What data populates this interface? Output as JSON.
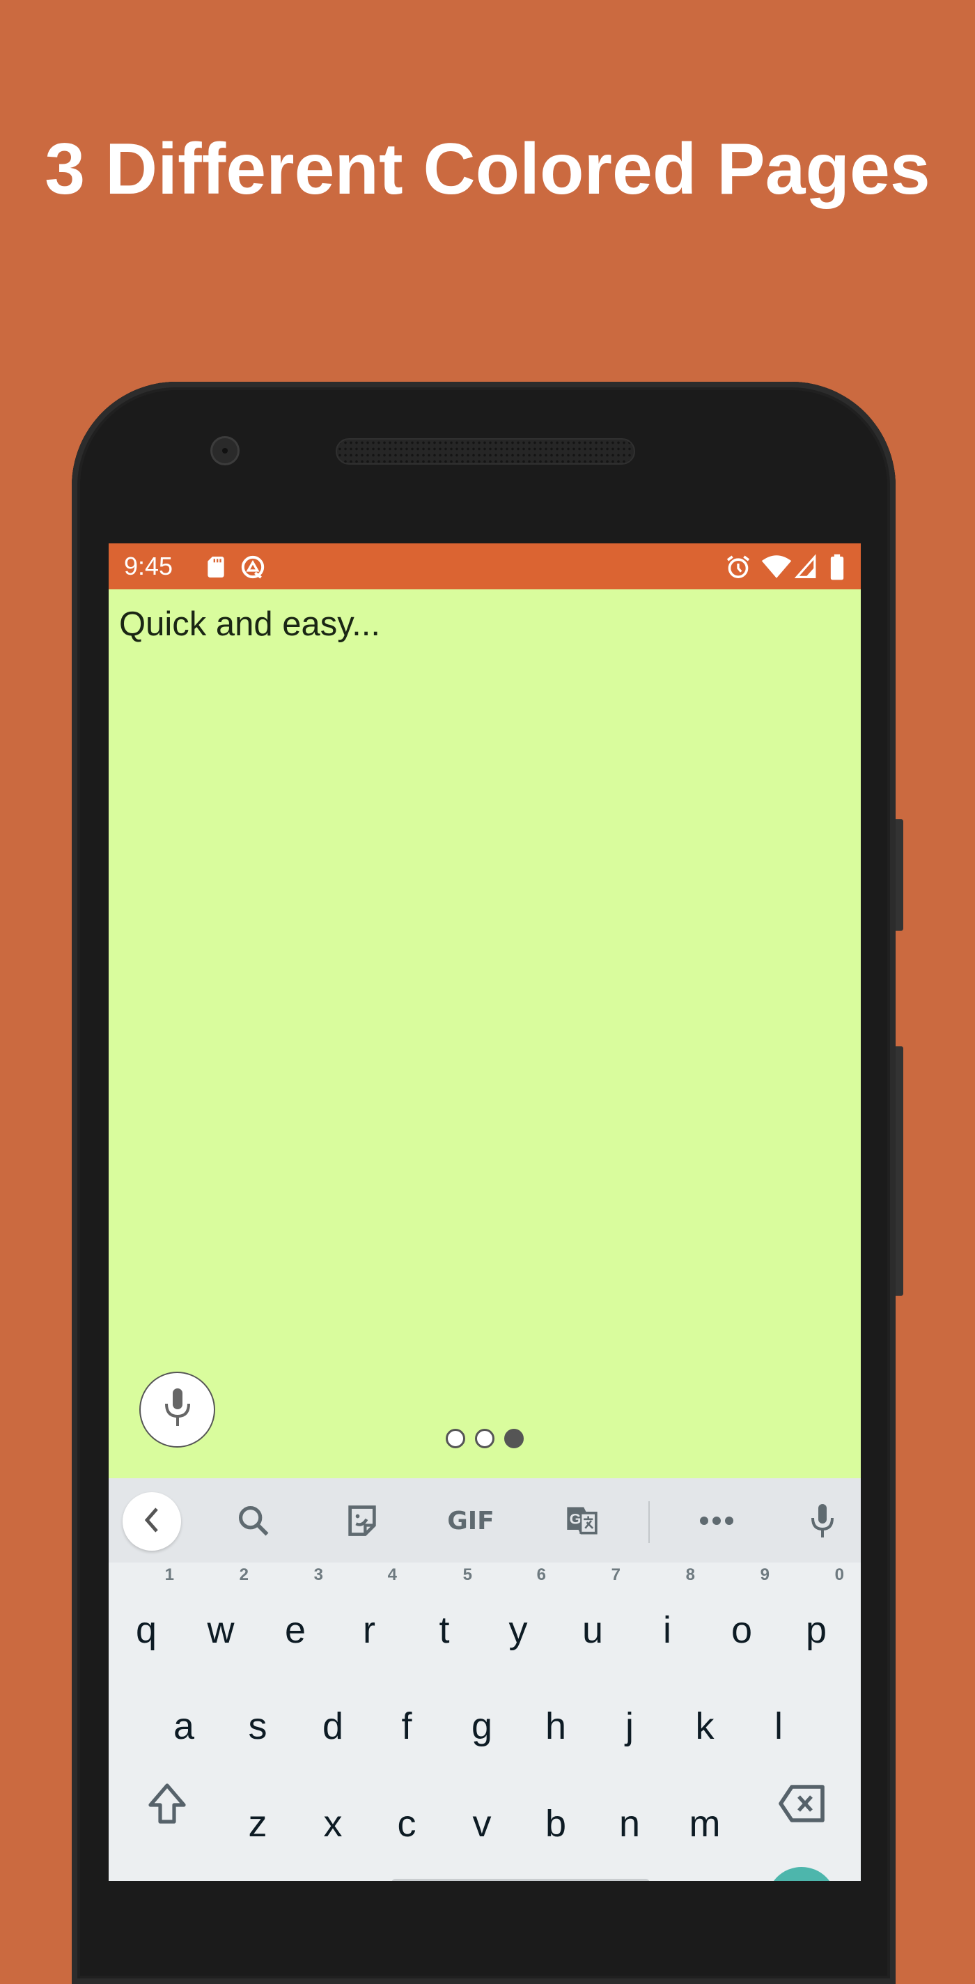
{
  "headline": "3 Different Colored Pages",
  "colors": {
    "background": "#CB6A40",
    "status_bar": "#DB6432",
    "page": "#D9FC9D",
    "keyboard_toolbar": "#E3E6E9",
    "keyboard_keys": "#ECEFF1",
    "enter_key": "#4DB6AC"
  },
  "status_bar": {
    "time": "9:45",
    "left_icons": [
      "sd-card-icon",
      "data-saver-icon"
    ],
    "right_icons": [
      "alarm-icon",
      "wifi-icon",
      "cell-signal-icon",
      "battery-icon"
    ]
  },
  "note": {
    "text": "Quick and easy..."
  },
  "mic_button": {
    "icon": "microphone-icon"
  },
  "page_indicator": {
    "total": 3,
    "active_index": 2
  },
  "keyboard": {
    "toolbar": [
      "back-chevron-icon",
      "search-icon",
      "sticker-icon",
      "gif-icon",
      "translate-icon",
      "more-icon",
      "microphone-icon"
    ],
    "gif_label": "GIF",
    "row1": [
      {
        "key": "q",
        "hint": "1"
      },
      {
        "key": "w",
        "hint": "2"
      },
      {
        "key": "e",
        "hint": "3"
      },
      {
        "key": "r",
        "hint": "4"
      },
      {
        "key": "t",
        "hint": "5"
      },
      {
        "key": "y",
        "hint": "6"
      },
      {
        "key": "u",
        "hint": "7"
      },
      {
        "key": "i",
        "hint": "8"
      },
      {
        "key": "o",
        "hint": "9"
      },
      {
        "key": "p",
        "hint": "0"
      }
    ],
    "row2": [
      "a",
      "s",
      "d",
      "f",
      "g",
      "h",
      "j",
      "k",
      "l"
    ],
    "row3": [
      "z",
      "x",
      "c",
      "v",
      "b",
      "n",
      "m"
    ]
  }
}
